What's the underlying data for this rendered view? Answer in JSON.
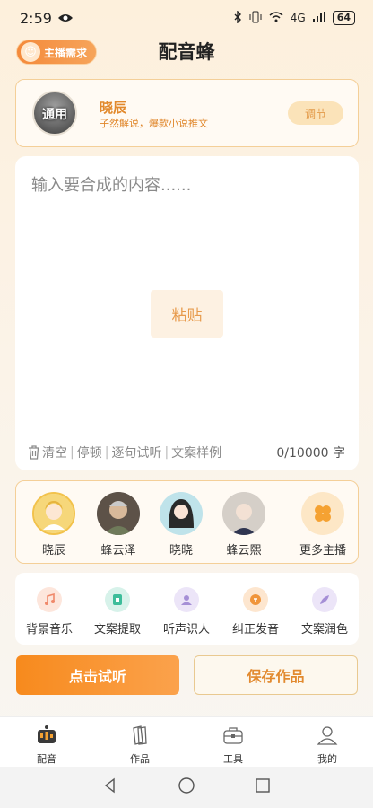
{
  "status": {
    "time": "2:59",
    "network": "4G",
    "battery": "64"
  },
  "header": {
    "anchor_button": "主播需求",
    "title": "配音蜂"
  },
  "voice": {
    "avatar_tag": "通用",
    "name": "晓辰",
    "description": "子然解说，爆款小说推文",
    "adjust": "调节"
  },
  "editor": {
    "placeholder": "输入要合成的内容......",
    "paste": "粘贴",
    "tools": [
      "清空",
      "停顿",
      "逐句试听",
      "文案样例"
    ],
    "count": "0/10000 字"
  },
  "anchors": [
    {
      "name": "晓辰"
    },
    {
      "name": "蜂云泽"
    },
    {
      "name": "晓晓"
    },
    {
      "name": "蜂云熙"
    },
    {
      "name": "更多主播"
    }
  ],
  "tools": [
    {
      "label": "背景音乐",
      "icon": "music-note-icon",
      "color": "#f39a7a"
    },
    {
      "label": "文案提取",
      "icon": "document-extract-icon",
      "color": "#3dbd9a"
    },
    {
      "label": "听声识人",
      "icon": "person-icon",
      "color": "#a58fd6"
    },
    {
      "label": "纠正发音",
      "icon": "pronunciation-icon",
      "color": "#f0953b"
    },
    {
      "label": "文案润色",
      "icon": "feather-icon",
      "color": "#a58fd6"
    }
  ],
  "actions": {
    "listen": "点击试听",
    "save": "保存作品"
  },
  "tabs": [
    "配音",
    "作品",
    "工具",
    "我的"
  ],
  "colors": {
    "accent": "#f78a1d",
    "border": "#f4cf98"
  }
}
